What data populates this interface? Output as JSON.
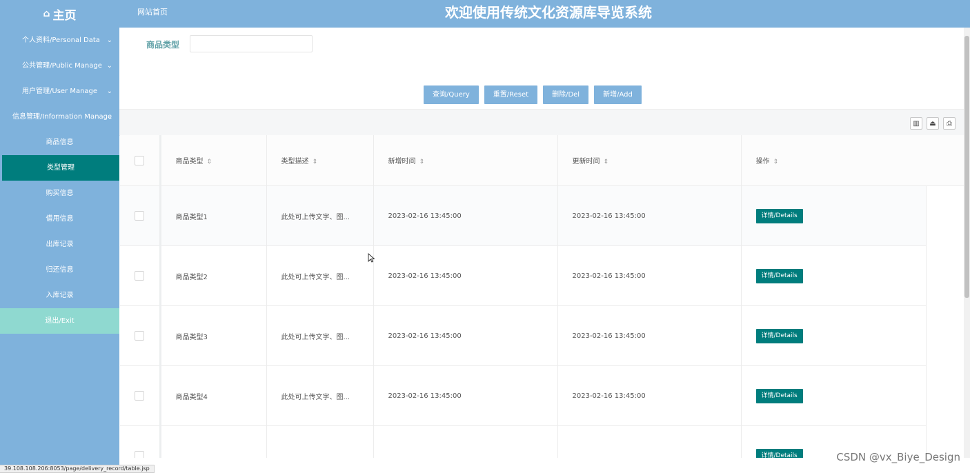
{
  "header": {
    "home_label": "主页",
    "site_home": "网站首页",
    "system_title": "欢迎使用传统文化资源库导览系统"
  },
  "sidebar": {
    "groups": [
      {
        "label": "个人资料/Personal Data"
      },
      {
        "label": "公共管理/Public Manage"
      },
      {
        "label": "用户管理/User Manage"
      },
      {
        "label": "信息管理/Information Manage"
      }
    ],
    "items": [
      {
        "label": "商品信息"
      },
      {
        "label": "类型管理"
      },
      {
        "label": "购买信息"
      },
      {
        "label": "借用信息"
      },
      {
        "label": "出库记录"
      },
      {
        "label": "归还信息"
      },
      {
        "label": "入库记录"
      }
    ],
    "exit_label": "退出/Exit"
  },
  "filter": {
    "label": "商品类型",
    "value": ""
  },
  "buttons": {
    "query": "查询/Query",
    "reset": "重置/Reset",
    "delete": "删除/Del",
    "add": "新增/Add"
  },
  "table": {
    "headers": [
      "商品类型",
      "类型描述",
      "新增时间",
      "更新时间",
      "操作"
    ],
    "detail_label": "详情/Details",
    "rows": [
      {
        "type": "商品类型1",
        "desc": "此处可上传文字、图...",
        "created": "2023-02-16 13:45:00",
        "updated": "2023-02-16 13:45:00"
      },
      {
        "type": "商品类型2",
        "desc": "此处可上传文字、图...",
        "created": "2023-02-16 13:45:00",
        "updated": "2023-02-16 13:45:00"
      },
      {
        "type": "商品类型3",
        "desc": "此处可上传文字、图...",
        "created": "2023-02-16 13:45:00",
        "updated": "2023-02-16 13:45:00"
      },
      {
        "type": "商品类型4",
        "desc": "此处可上传文字、图...",
        "created": "2023-02-16 13:45:00",
        "updated": "2023-02-16 13:45:00"
      }
    ]
  },
  "status_url": "39.108.108.206:8053/page/delivery_record/table.jsp",
  "watermark": "CSDN @vx_Biye_Design",
  "colors": {
    "primary": "#7fb2dc",
    "active": "#007d7d",
    "exit": "#8fd9d0"
  }
}
